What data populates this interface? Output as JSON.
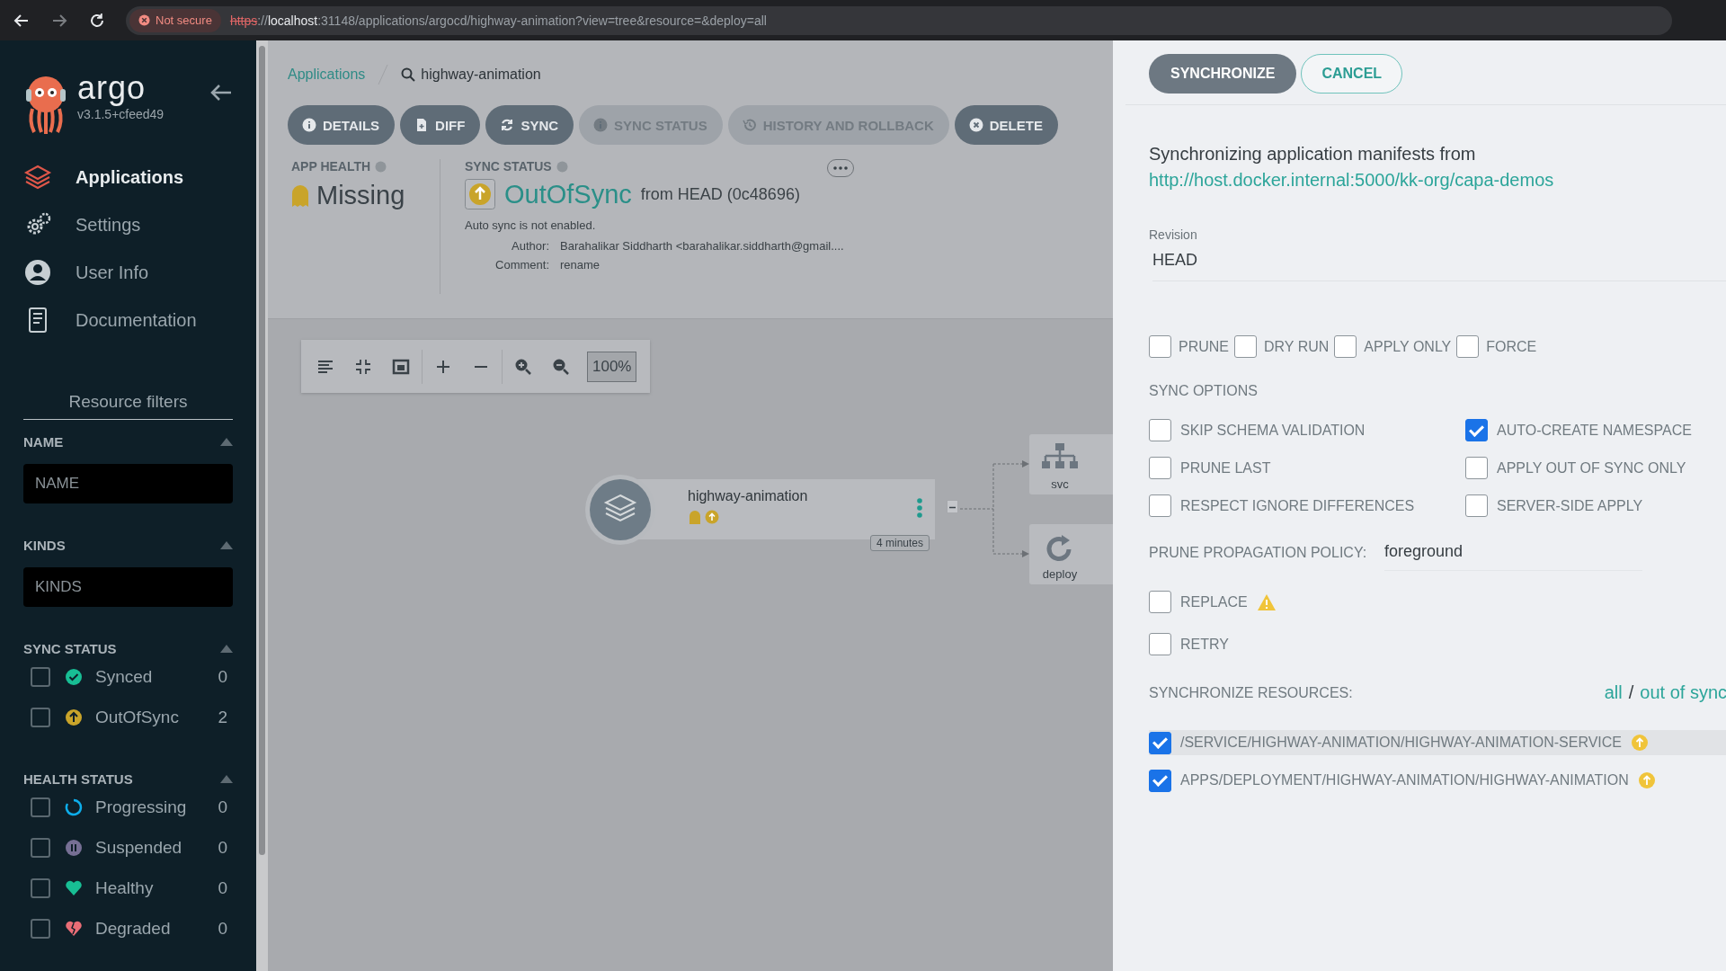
{
  "browser": {
    "security": "Not secure",
    "url": [
      {
        "kind": "scheme",
        "text": "https"
      },
      {
        "kind": "plain",
        "text": "://"
      },
      {
        "kind": "host",
        "text": "localhost"
      },
      {
        "kind": "path",
        "text": ":31148/applications/argocd/highway-animation?view=tree&resource=&deploy=all"
      }
    ]
  },
  "sidebar": {
    "logo": "argo",
    "version": "v3.1.5+cfeed49",
    "nav": [
      {
        "label": "Applications",
        "selected": true
      },
      {
        "label": "Settings",
        "selected": false
      },
      {
        "label": "User Info",
        "selected": false
      },
      {
        "label": "Documentation",
        "selected": false
      }
    ],
    "filters_title": "Resource filters",
    "sections": [
      {
        "kind": "input",
        "title": "NAME",
        "placeholder": "NAME"
      },
      {
        "kind": "input",
        "title": "KINDS",
        "placeholder": "KINDS"
      },
      {
        "kind": "checklist",
        "title": "SYNC STATUS",
        "items": [
          {
            "label": "Synced",
            "count": "0",
            "color": "#18be94",
            "checked": false
          },
          {
            "label": "OutOfSync",
            "count": "2",
            "color": "#c9a42a",
            "checked": false
          }
        ]
      },
      {
        "kind": "checklist",
        "title": "HEALTH STATUS",
        "items": [
          {
            "label": "Progressing",
            "count": "0",
            "color": "#0dadea",
            "checked": false
          },
          {
            "label": "Suspended",
            "count": "0",
            "color": "#766f94",
            "checked": false
          },
          {
            "label": "Healthy",
            "count": "0",
            "color": "#18be94",
            "checked": false
          },
          {
            "label": "Degraded",
            "count": "0",
            "color": "#e96d76",
            "checked": false
          }
        ]
      }
    ]
  },
  "main": {
    "breadcrumb": {
      "link": "Applications",
      "current": "highway-animation"
    },
    "actions": [
      {
        "label": "DETAILS",
        "disabled": false
      },
      {
        "label": "DIFF",
        "disabled": false
      },
      {
        "label": "SYNC",
        "disabled": false
      },
      {
        "label": "SYNC STATUS",
        "disabled": true
      },
      {
        "label": "HISTORY AND ROLLBACK",
        "disabled": true
      },
      {
        "label": "DELETE",
        "disabled": false
      }
    ],
    "app_health": {
      "label": "APP HEALTH",
      "value": "Missing"
    },
    "sync_status": {
      "label": "SYNC STATUS",
      "value": "OutOfSync",
      "source": "from HEAD (0c48696)",
      "note": "Auto sync is not enabled.",
      "author_label": "Author:",
      "author": "Barahalikar Siddharth <barahalikar.siddharth@gmail....",
      "comment_label": "Comment:",
      "comment": "rename"
    },
    "graph": {
      "zoom": "100%",
      "app_node": {
        "name": "highway-animation",
        "age": "4 minutes"
      },
      "children": [
        {
          "kind": "svc",
          "label": "svc"
        },
        {
          "kind": "deploy",
          "label": "deploy"
        }
      ]
    }
  },
  "panel": {
    "buttons": [
      {
        "label": "SYNCHRONIZE"
      },
      {
        "label": "CANCEL"
      }
    ],
    "intro": "Synchronizing application manifests from",
    "repo": "http://host.docker.internal:5000/kk-org/capa-demos",
    "revision_label": "Revision",
    "revision": "HEAD",
    "flags": [
      {
        "label": "PRUNE",
        "checked": false
      },
      {
        "label": "DRY RUN",
        "checked": false
      },
      {
        "label": "APPLY ONLY",
        "checked": false
      },
      {
        "label": "FORCE",
        "checked": false
      }
    ],
    "options_title": "SYNC OPTIONS",
    "options": [
      {
        "label": "SKIP SCHEMA VALIDATION",
        "checked": false
      },
      {
        "label": "AUTO-CREATE NAMESPACE",
        "checked": true
      },
      {
        "label": "PRUNE LAST",
        "checked": false
      },
      {
        "label": "APPLY OUT OF SYNC ONLY",
        "checked": false
      },
      {
        "label": "RESPECT IGNORE DIFFERENCES",
        "checked": false
      },
      {
        "label": "SERVER-SIDE APPLY",
        "checked": false
      }
    ],
    "policy_label": "PRUNE PROPAGATION POLICY:",
    "policy": "foreground",
    "replace": {
      "label": "REPLACE",
      "checked": false,
      "warning": true
    },
    "retry": {
      "label": "RETRY",
      "checked": false
    },
    "resources_label": "SYNCHRONIZE RESOURCES:",
    "select_all": "all",
    "separator": "/",
    "select_out": "out of sync",
    "resources": [
      {
        "label": "/SERVICE/HIGHWAY-ANIMATION/HIGHWAY-ANIMATION-SERVICE",
        "checked": true,
        "hovered": true
      },
      {
        "label": "APPS/DEPLOYMENT/HIGHWAY-ANIMATION/HIGHWAY-ANIMATION",
        "checked": true,
        "hovered": false
      }
    ]
  }
}
